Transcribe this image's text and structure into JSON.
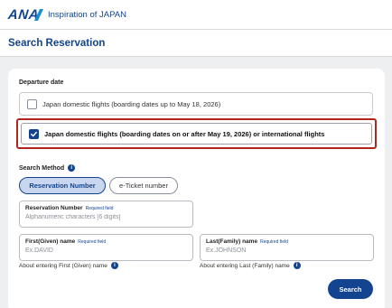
{
  "header": {
    "logo_text": "ANA",
    "tagline": "Inspiration of JAPAN"
  },
  "page": {
    "title": "Search Reservation"
  },
  "departure": {
    "label": "Departure date",
    "options": [
      {
        "label": "Japan domestic flights (boarding dates up to May 18, 2026)",
        "checked": false
      },
      {
        "label": "Japan domestic flights (boarding dates on or after May 19, 2026) or international flights",
        "checked": true
      }
    ]
  },
  "search_method": {
    "label": "Search Method",
    "info_icon": "info-icon",
    "tabs": [
      {
        "label": "Reservation Number",
        "active": true
      },
      {
        "label": "e-Ticket number",
        "active": false
      }
    ]
  },
  "form": {
    "reservation_number": {
      "label": "Reservation Number",
      "required": "Required field",
      "placeholder": "Alphanumeric characters [6 digits]"
    },
    "first_name": {
      "label": "First(Given) name",
      "required": "Required field",
      "placeholder": "Ex.DAVID",
      "note": "About entering First (Given) name"
    },
    "last_name": {
      "label": "Last(Family) name",
      "required": "Required field",
      "placeholder": "Ex.JOHNSON",
      "note": "About entering Last (Family) name"
    },
    "search_label": "Search"
  },
  "colors": {
    "brand": "#13448f",
    "highlight_frame": "#b3261e",
    "background": "#eeeff1"
  }
}
